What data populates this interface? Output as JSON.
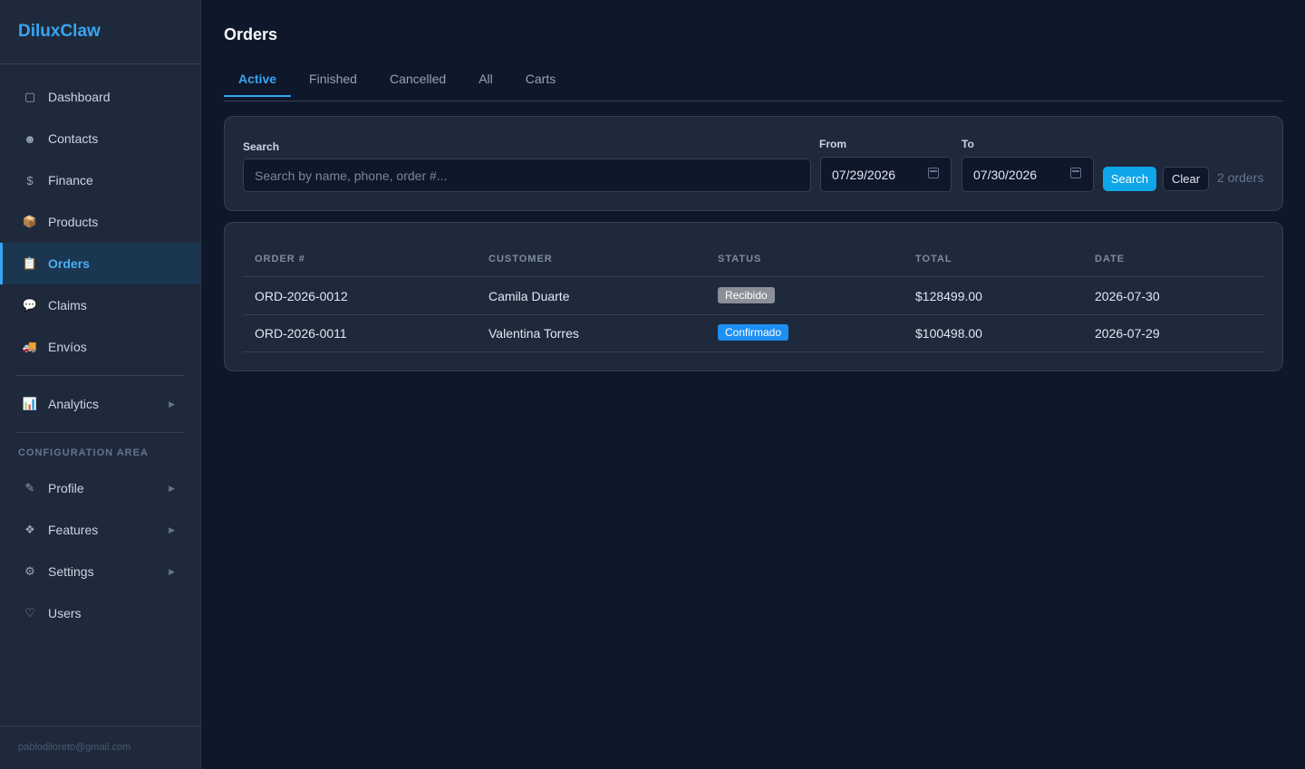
{
  "app": {
    "brand": "DiluxClaw"
  },
  "sidebar": {
    "items": [
      {
        "label": "Dashboard",
        "icon": "square-icon",
        "glyph": "▢"
      },
      {
        "label": "Contacts",
        "icon": "contact-icon",
        "glyph": "☻"
      },
      {
        "label": "Finance",
        "icon": "dollar-icon",
        "glyph": "$"
      },
      {
        "label": "Products",
        "icon": "package-icon",
        "glyph": "📦"
      },
      {
        "label": "Orders",
        "icon": "clipboard-icon",
        "glyph": "📋",
        "active": true
      },
      {
        "label": "Claims",
        "icon": "speech-bubble-icon",
        "glyph": "💬"
      },
      {
        "label": "Envíos",
        "icon": "truck-icon",
        "glyph": "🚚"
      }
    ],
    "analytics": {
      "label": "Analytics",
      "icon": "bar-chart-icon",
      "glyph": "📊",
      "arrow": "▶"
    },
    "config_section_label": "CONFIGURATION AREA",
    "config_items": [
      {
        "label": "Profile",
        "icon": "pen-icon",
        "glyph": "✎",
        "arrow": "▶"
      },
      {
        "label": "Features",
        "icon": "features-icon",
        "glyph": "❖",
        "arrow": "▶"
      },
      {
        "label": "Settings",
        "icon": "gear-icon",
        "glyph": "⚙",
        "arrow": "▶"
      },
      {
        "label": "Users",
        "icon": "shield-icon",
        "glyph": "♡"
      }
    ],
    "footer_email": "pablodiloreto@gmail.com"
  },
  "main": {
    "title": "Orders",
    "tabs": [
      {
        "label": "Active",
        "active": true
      },
      {
        "label": "Finished"
      },
      {
        "label": "Cancelled"
      },
      {
        "label": "All"
      },
      {
        "label": "Carts"
      }
    ],
    "filters": {
      "search_label": "Search",
      "search_placeholder": "Search by name, phone, order #...",
      "search_value": "",
      "from_label": "From",
      "from_value": "07/29/2026",
      "to_label": "To",
      "to_value": "07/30/2026",
      "search_button": "Search",
      "clear_button": "Clear",
      "count_text": "2 orders"
    },
    "table": {
      "columns": [
        "ORDER #",
        "CUSTOMER",
        "STATUS",
        "TOTAL",
        "DATE"
      ],
      "rows": [
        {
          "order": "ORD-2026-0012",
          "customer": "Camila Duarte",
          "status": "Recibido",
          "status_color": "#8a8f98",
          "total": "$128499.00",
          "date": "2026-07-30"
        },
        {
          "order": "ORD-2026-0011",
          "customer": "Valentina Torres",
          "status": "Confirmado",
          "status_color": "#1d8ff2",
          "total": "$100498.00",
          "date": "2026-07-29"
        }
      ]
    }
  },
  "colors": {
    "background": "#0f172a",
    "sidebar": "#1e293b",
    "accent": "#38a5f0",
    "primary_button": "#0ea5e9"
  }
}
